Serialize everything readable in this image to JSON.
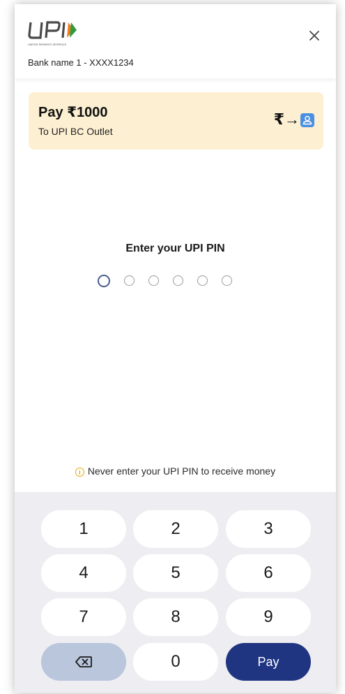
{
  "header": {
    "logo_text": "UPI",
    "logo_subtext": "UNIFIED PAYMENTS INTERFACE",
    "bank_line": "Bank name 1 - XXXX1234"
  },
  "payment": {
    "amount_label": "Pay ₹1000",
    "payee_label": "To UPI BC Outlet",
    "transfer_icon": "₹→"
  },
  "pin": {
    "title": "Enter your UPI PIN",
    "length": 6
  },
  "warning": {
    "text": "Never enter your UPI PIN to receive money"
  },
  "keypad": {
    "keys": [
      "1",
      "2",
      "3",
      "4",
      "5",
      "6",
      "7",
      "8",
      "9"
    ],
    "zero": "0",
    "pay_label": "Pay"
  },
  "colors": {
    "pay_card_bg": "#fdf0d2",
    "keypad_bg": "#eeedf2",
    "pay_button": "#1f3581",
    "backspace_button": "#b9c6dc",
    "active_dot": "#4a5c8c",
    "warning_icon": "#e6a700"
  }
}
